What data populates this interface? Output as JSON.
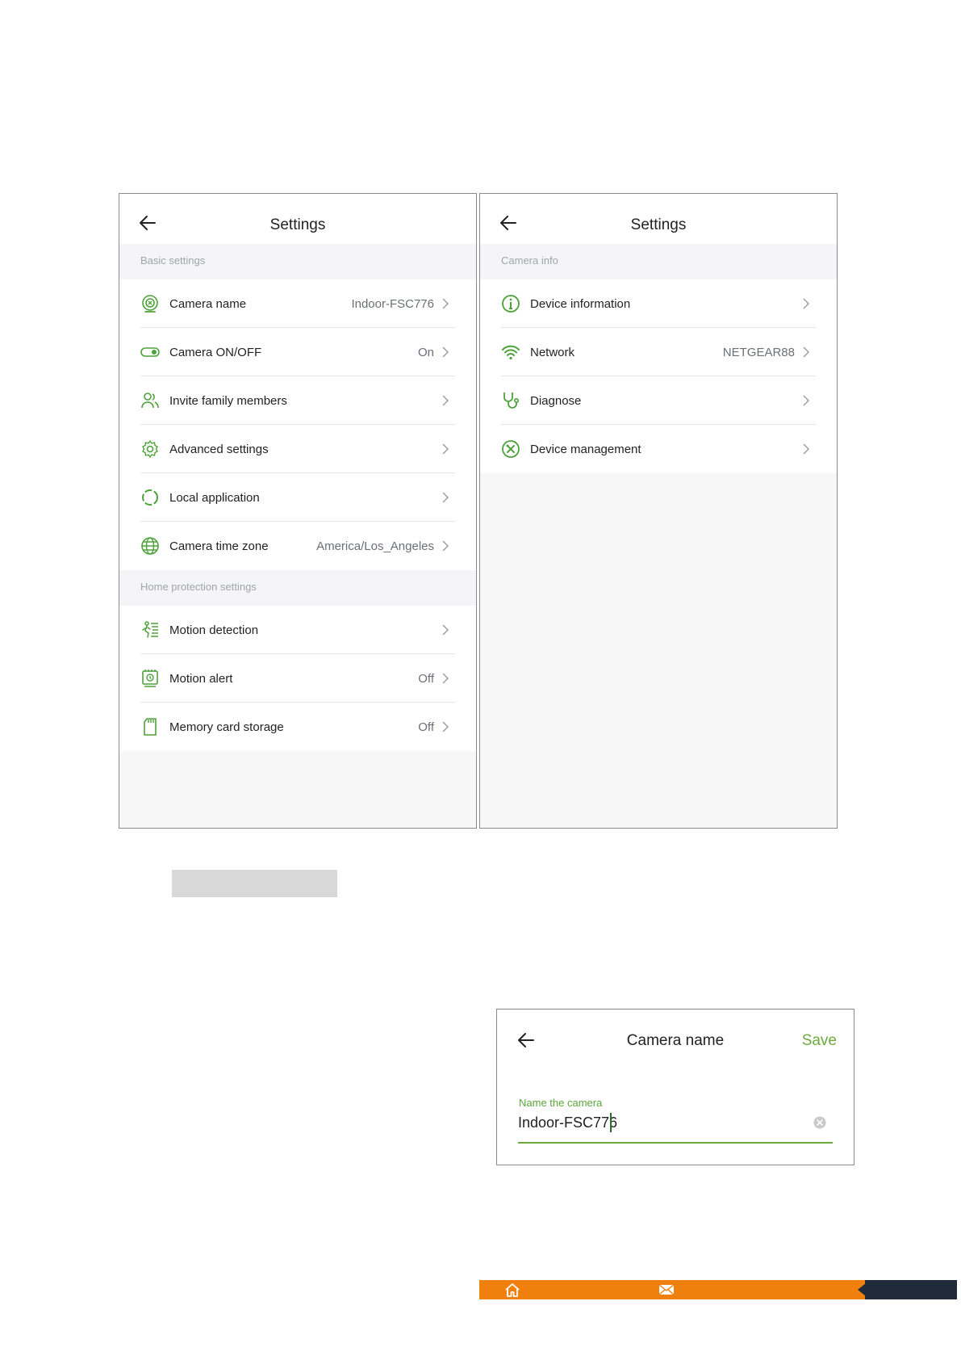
{
  "settings_main": {
    "title": "Settings",
    "sections": [
      {
        "label": "Basic settings",
        "rows": [
          {
            "label": "Camera name",
            "value": "Indoor-FSC776",
            "icon": "camera-name-icon"
          },
          {
            "label": "Camera ON/OFF",
            "value": "On",
            "icon": "toggle-icon"
          },
          {
            "label": "Invite family members",
            "value": "",
            "icon": "family-members-icon"
          },
          {
            "label": "Advanced settings",
            "value": "",
            "icon": "gear-icon"
          },
          {
            "label": "Local application",
            "value": "",
            "icon": "local-application-icon"
          },
          {
            "label": "Camera time zone",
            "value": "America/Los_Angeles",
            "icon": "globe-icon"
          }
        ]
      },
      {
        "label": "Home protection settings",
        "rows": [
          {
            "label": "Motion detection",
            "value": "",
            "icon": "motion-detection-icon"
          },
          {
            "label": "Motion alert",
            "value": "Off",
            "icon": "motion-alert-icon"
          },
          {
            "label": "Memory card storage",
            "value": "Off",
            "icon": "memory-card-icon"
          }
        ]
      }
    ]
  },
  "settings_info": {
    "title": "Settings",
    "sections": [
      {
        "label": "Camera info",
        "rows": [
          {
            "label": "Device information",
            "value": "",
            "icon": "info-icon"
          },
          {
            "label": "Network",
            "value": "NETGEAR88",
            "icon": "wifi-icon"
          },
          {
            "label": "Diagnose",
            "value": "",
            "icon": "stethoscope-icon"
          },
          {
            "label": "Device management",
            "value": "",
            "icon": "tools-icon"
          }
        ]
      }
    ]
  },
  "camera_name": {
    "title": "Camera name",
    "save_label": "Save",
    "field_label": "Name the camera",
    "field_value": "Indoor-FSC776"
  },
  "colors": {
    "accent_green": "#6caa3e",
    "bottom_bar_orange": "#f0800e",
    "bottom_bar_dark": "#1f2b38"
  }
}
